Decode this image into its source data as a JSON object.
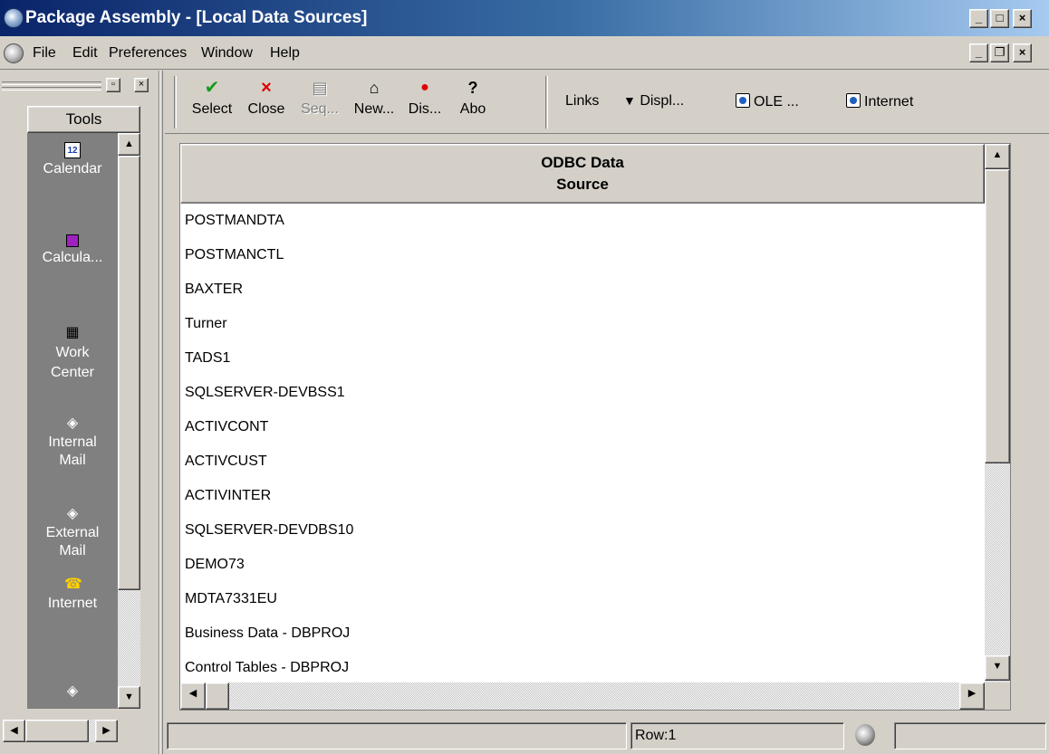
{
  "window": {
    "title": "Package Assembly - [Local Data Sources]",
    "controls": {
      "minimize": "_",
      "maximize": "□",
      "close": "×"
    },
    "doc_controls": {
      "minimize": "_",
      "restore": "❐",
      "close": "×"
    }
  },
  "menu": {
    "items": [
      "File",
      "Edit",
      "Preferences",
      "Window",
      "Help"
    ]
  },
  "tools": {
    "header": "Tools",
    "items": [
      {
        "label": "Calendar",
        "icon": "calendar-icon"
      },
      {
        "label": "Calcula...",
        "icon": "calculator-icon"
      },
      {
        "label": "Work Center",
        "icon": "work-center-icon"
      },
      {
        "label": "Internal Mail",
        "icon": "internal-mail-icon"
      },
      {
        "label": "External Mail",
        "icon": "external-mail-icon"
      },
      {
        "label": "Internet",
        "icon": "internet-phone-icon"
      }
    ]
  },
  "toolbar": {
    "buttons": [
      {
        "label": "Select",
        "icon": "checkmark-icon",
        "enabled": true
      },
      {
        "label": "Close",
        "icon": "close-x-icon",
        "enabled": true
      },
      {
        "label": "Seq...",
        "icon": "sequence-icon",
        "enabled": false
      },
      {
        "label": "New...",
        "icon": "new-icon",
        "enabled": true
      },
      {
        "label": "Dis...",
        "icon": "display-icon",
        "enabled": true
      },
      {
        "label": "Abo",
        "icon": "about-help-icon",
        "enabled": true
      }
    ],
    "links": [
      {
        "label": "Links"
      },
      {
        "label": "Displ..."
      },
      {
        "label": "OLE ..."
      },
      {
        "label": "Internet"
      }
    ]
  },
  "grid": {
    "column_header_line1": "ODBC Data",
    "column_header_line2": "Source",
    "rows": [
      "POSTMANDTA",
      "POSTMANCTL",
      "BAXTER",
      "Turner",
      "TADS1",
      "SQLSERVER-DEVBSS1",
      "ACTIVCONT",
      "ACTIVCUST",
      "ACTIVINTER",
      "SQLSERVER-DEVDBS10",
      "DEMO73",
      "MDTA7331EU",
      "Business Data - DBPROJ",
      "Control Tables - DBPROJ"
    ]
  },
  "status": {
    "row": "Row:1"
  }
}
